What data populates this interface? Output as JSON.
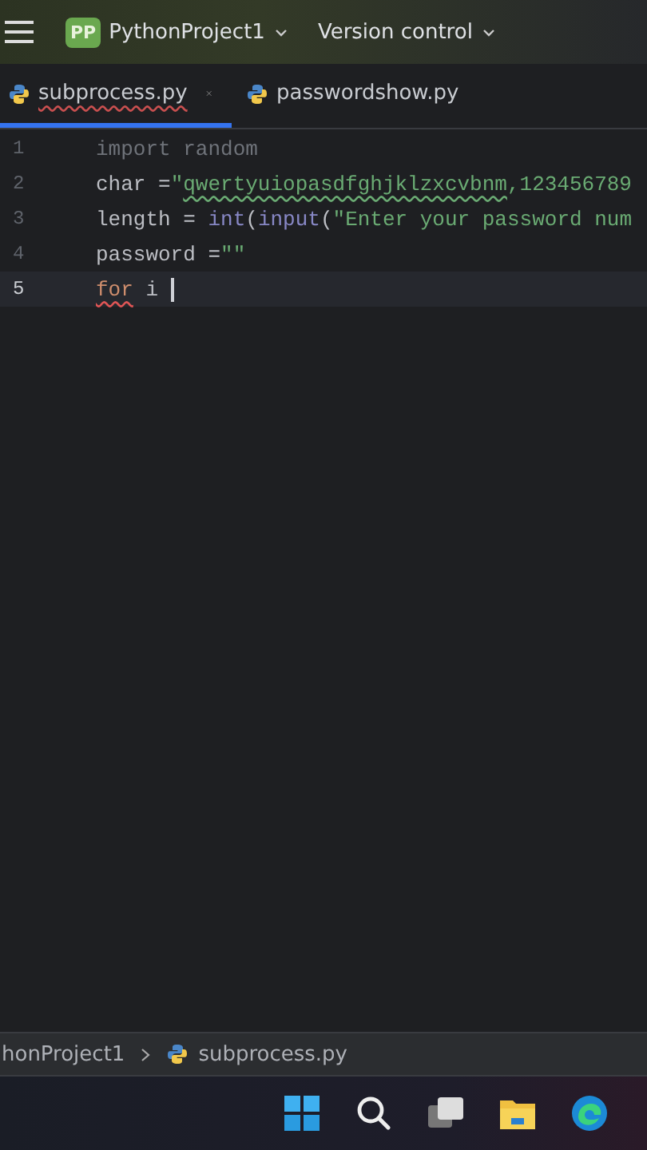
{
  "header": {
    "project_badge": "PP",
    "project": "PythonProject1",
    "vcs": "Version control"
  },
  "tabs": [
    {
      "label": "subprocess.py",
      "selected": true,
      "closable": true,
      "error": true
    },
    {
      "label": "passwordshow.py",
      "selected": false,
      "closable": false,
      "error": false
    }
  ],
  "editor": {
    "lines": [
      {
        "number": "1",
        "current": false,
        "tokens": [
          {
            "kind": "unused",
            "text": "import random"
          }
        ]
      },
      {
        "number": "2",
        "current": false,
        "tokens": [
          {
            "kind": "plain",
            "text": "char ="
          },
          {
            "kind": "string",
            "text": "\""
          },
          {
            "kind": "string-typo",
            "text": "qwertyuiopasdfghjklzxcvbnm"
          },
          {
            "kind": "string",
            "text": ",123456789"
          }
        ]
      },
      {
        "number": "3",
        "current": false,
        "tokens": [
          {
            "kind": "plain",
            "text": "length = "
          },
          {
            "kind": "builtin",
            "text": "int"
          },
          {
            "kind": "plain",
            "text": "("
          },
          {
            "kind": "builtin",
            "text": "input"
          },
          {
            "kind": "plain",
            "text": "("
          },
          {
            "kind": "string",
            "text": "\"Enter your password num"
          }
        ]
      },
      {
        "number": "4",
        "current": false,
        "tokens": [
          {
            "kind": "plain",
            "text": "password ="
          },
          {
            "kind": "string",
            "text": "\"\""
          }
        ]
      },
      {
        "number": "5",
        "current": true,
        "caret": true,
        "tokens": [
          {
            "kind": "keyword-error",
            "text": "for"
          },
          {
            "kind": "plain",
            "text": " i "
          }
        ]
      }
    ]
  },
  "breadcrumb": [
    {
      "label": "honProject1",
      "icon": false
    },
    {
      "label": "subprocess.py",
      "icon": true
    }
  ]
}
